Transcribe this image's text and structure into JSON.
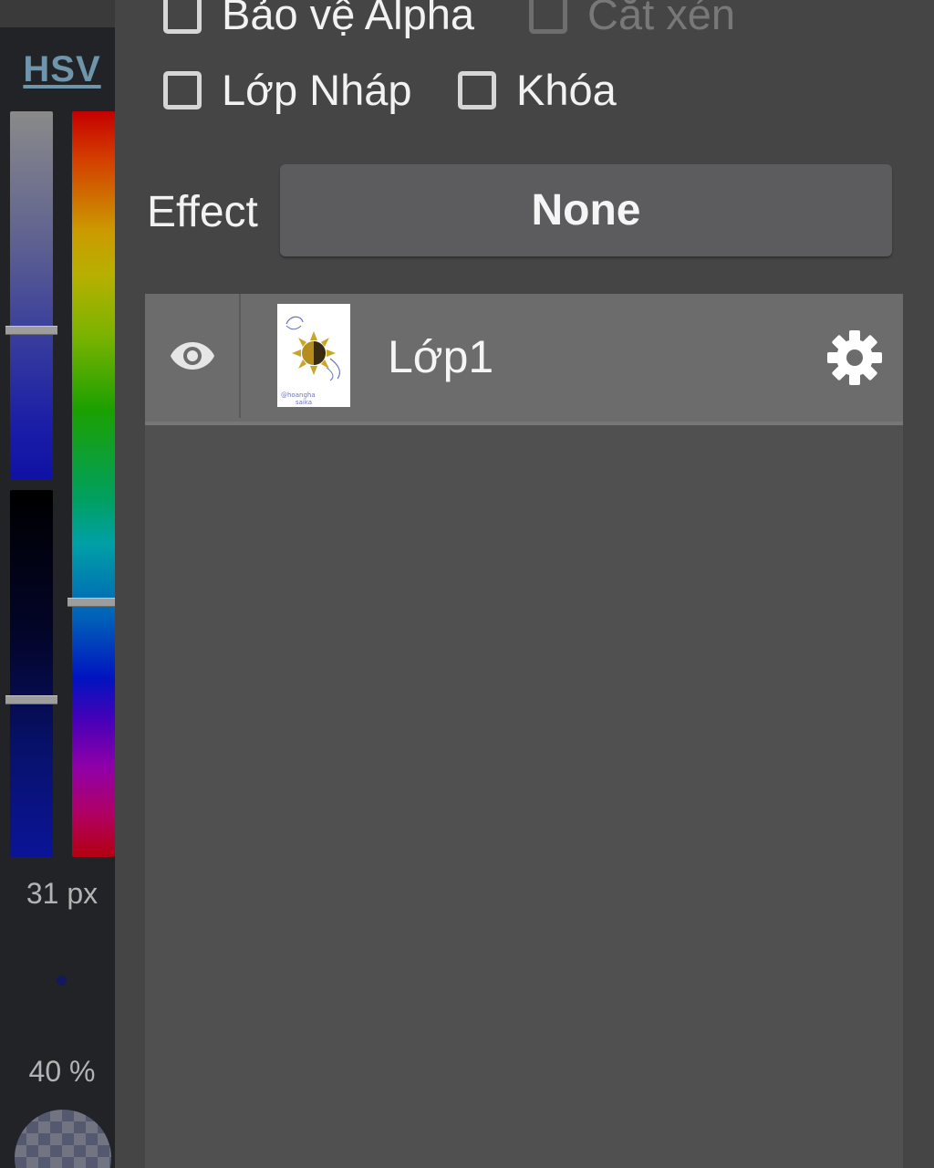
{
  "color_panel": {
    "mode_label": "HSV",
    "brush_size": "31 px",
    "opacity": "40 %",
    "sliders": {
      "saturation_level": 0.6,
      "value_level": 0.57,
      "hue_level": 0.66
    }
  },
  "layer_options": {
    "alpha_protect": {
      "label": "Bảo vệ Alpha",
      "checked": false
    },
    "clipping": {
      "label": "Cắt xén",
      "checked": false,
      "enabled": false
    },
    "draft_layer": {
      "label": "Lớp Nháp",
      "checked": false
    },
    "lock": {
      "label": "Khóa",
      "checked": false
    }
  },
  "effect": {
    "label": "Effect",
    "value": "None"
  },
  "layers": [
    {
      "name": "Lớp1",
      "visible": true,
      "thumbnail_caption": "@hoangha\nsaika"
    }
  ],
  "colors": {
    "accent_link": "#6f95ad",
    "panel_bg": "#454545",
    "toolbar_bg": "#222326",
    "layer_row_bg": "#6c6c6c",
    "layer_list_bg": "#505050"
  }
}
